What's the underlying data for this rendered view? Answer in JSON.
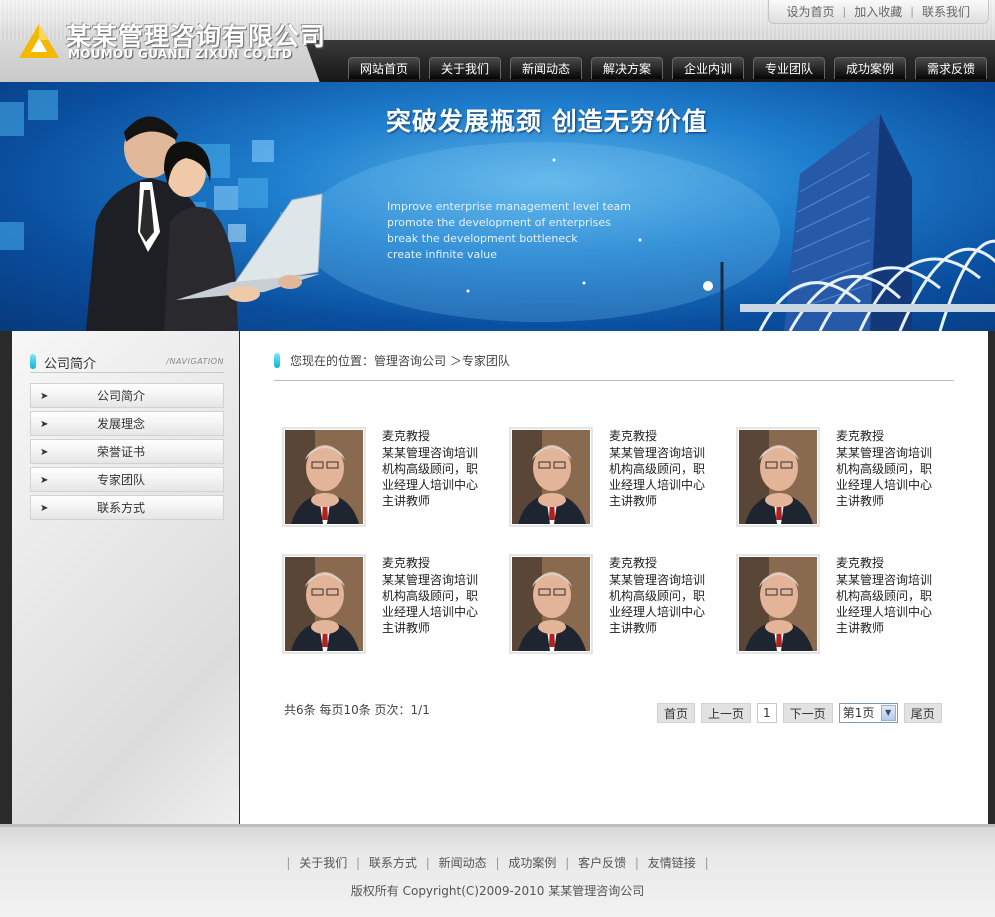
{
  "header": {
    "logo_cn": "某某管理咨询有限公司",
    "logo_en": "MOUMOU GUANLI ZIXUN CO,LTD",
    "top_links": [
      "设为首页",
      "加入收藏",
      "联系我们"
    ],
    "nav": [
      "网站首页",
      "关于我们",
      "新闻动态",
      "解决方案",
      "企业内训",
      "专业团队",
      "成功案例",
      "需求反馈"
    ]
  },
  "banner": {
    "headline": "突破发展瓶颈 创造无穷价值",
    "sub_lines": [
      "Improve enterprise management level team",
      "promote the development of enterprises",
      "break the development bottleneck",
      "create infinite value"
    ]
  },
  "sidebar": {
    "title": "公司简介",
    "nav_tag": "/NAVIGATION",
    "items": [
      "公司简介",
      "发展理念",
      "荣誉证书",
      "专家团队",
      "联系方式"
    ]
  },
  "content": {
    "breadcrumb": "您现在的位置：管理咨询公司 ＞专家团队",
    "experts": [
      {
        "name": "麦克教授",
        "desc": "某某管理咨询培训机构高级顾问，职业经理人培训中心主讲教师"
      },
      {
        "name": "麦克教授",
        "desc": "某某管理咨询培训机构高级顾问，职业经理人培训中心主讲教师"
      },
      {
        "name": "麦克教授",
        "desc": "某某管理咨询培训机构高级顾问，职业经理人培训中心主讲教师"
      },
      {
        "name": "麦克教授",
        "desc": "某某管理咨询培训机构高级顾问，职业经理人培训中心主讲教师"
      },
      {
        "name": "麦克教授",
        "desc": "某某管理咨询培训机构高级顾问，职业经理人培训中心主讲教师"
      },
      {
        "name": "麦克教授",
        "desc": "某某管理咨询培训机构高级顾问，职业经理人培训中心主讲教师"
      }
    ],
    "page_info": "共6条  每页10条  页次：1/1",
    "pager": {
      "first": "首页",
      "prev": "上一页",
      "current": "1",
      "next": "下一页",
      "select_value": "第1页",
      "last": "尾页"
    }
  },
  "footer": {
    "links": [
      "关于我们",
      "联系方式",
      "新闻动态",
      "成功案例",
      "客户反馈",
      "友情链接"
    ],
    "copyright": "版权所有  Copyright(C)2009-2010 某某管理咨询公司"
  },
  "colors": {
    "accent_cyan": "#0ab0d6",
    "nav_bg": "#1a1a1a",
    "banner_blue": "#1f7fce",
    "logo_yellow": "#f5b800"
  }
}
